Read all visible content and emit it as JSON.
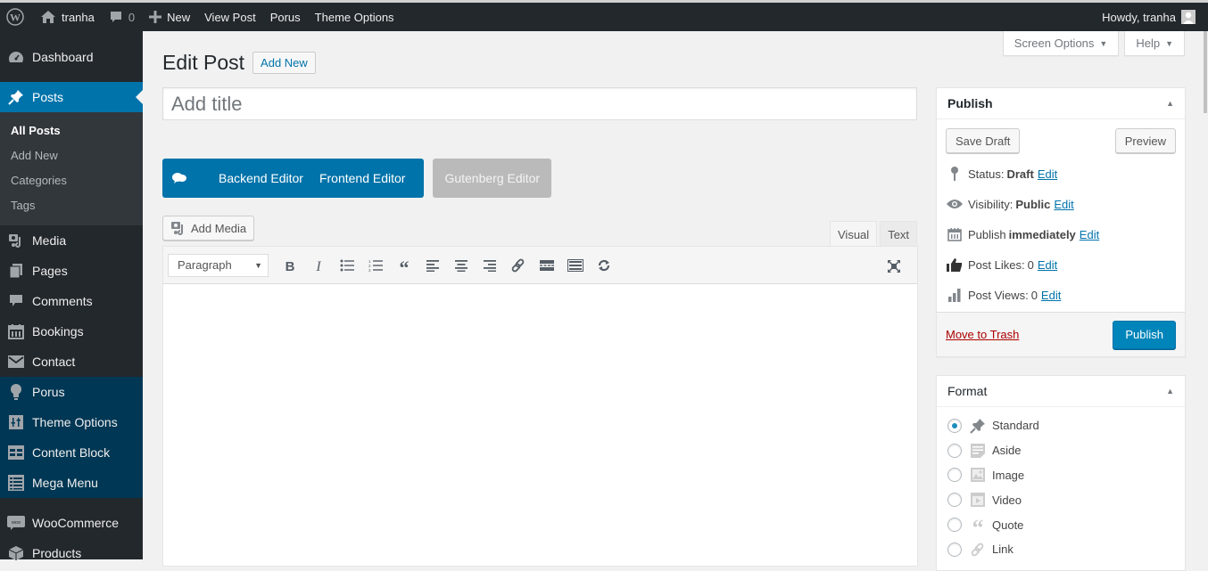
{
  "admin_bar": {
    "site_name": "tranha",
    "comments_count": "0",
    "new_label": "New",
    "view_post": "View Post",
    "porus": "Porus",
    "theme_options": "Theme Options",
    "howdy": "Howdy, tranha"
  },
  "sidebar": {
    "items": [
      {
        "label": "Dashboard",
        "icon": "dashboard-icon"
      },
      {
        "label": "Posts",
        "icon": "pin-icon",
        "current": true
      },
      {
        "label": "Media",
        "icon": "media-icon"
      },
      {
        "label": "Pages",
        "icon": "pages-icon"
      },
      {
        "label": "Comments",
        "icon": "comment-icon"
      },
      {
        "label": "Bookings",
        "icon": "calendar-icon"
      },
      {
        "label": "Contact",
        "icon": "mail-icon"
      },
      {
        "label": "Porus",
        "icon": "lightbulb-icon"
      },
      {
        "label": "Theme Options",
        "icon": "sliders-icon"
      },
      {
        "label": "Content Block",
        "icon": "table-icon"
      },
      {
        "label": "Mega Menu",
        "icon": "list-icon"
      },
      {
        "label": "WooCommerce",
        "icon": "woo-icon"
      },
      {
        "label": "Products",
        "icon": "box-icon"
      }
    ],
    "submenu": [
      {
        "label": "All Posts",
        "current": true
      },
      {
        "label": "Add New"
      },
      {
        "label": "Categories"
      },
      {
        "label": "Tags"
      }
    ]
  },
  "screen_meta": {
    "screen_options": "Screen Options",
    "help": "Help"
  },
  "main": {
    "title": "Edit Post",
    "add_new": "Add New",
    "title_placeholder": "Add title",
    "composer": {
      "backend": "Backend Editor",
      "frontend": "Frontend Editor",
      "gutenberg": "Gutenberg Editor"
    },
    "add_media": "Add Media",
    "tabs": {
      "visual": "Visual",
      "text": "Text"
    },
    "format_select": "Paragraph",
    "toolbar_buttons": [
      "bold",
      "italic",
      "bulleted-list",
      "numbered-list",
      "blockquote",
      "align-left",
      "align-center",
      "align-right",
      "link",
      "read-more",
      "toolbar-toggle",
      "refresh"
    ]
  },
  "publish": {
    "heading": "Publish",
    "save_draft": "Save Draft",
    "preview": "Preview",
    "status_label": "Status:",
    "status_value": "Draft",
    "visibility_label": "Visibility:",
    "visibility_value": "Public",
    "publish_label": "Publish",
    "publish_value": "immediately",
    "likes_label": "Post Likes:",
    "likes_value": "0",
    "views_label": "Post Views:",
    "views_value": "0",
    "edit": "Edit",
    "move_to_trash": "Move to Trash",
    "publish_button": "Publish"
  },
  "format": {
    "heading": "Format",
    "options": [
      {
        "label": "Standard",
        "checked": true
      },
      {
        "label": "Aside"
      },
      {
        "label": "Image"
      },
      {
        "label": "Video"
      },
      {
        "label": "Quote"
      },
      {
        "label": "Link"
      }
    ]
  },
  "colors": {
    "accent": "#0073aa",
    "admin_bar": "#23282d",
    "theme_menu_bg": "#003754",
    "primary_button": "#0085ba",
    "trash_link": "#aa0000"
  }
}
